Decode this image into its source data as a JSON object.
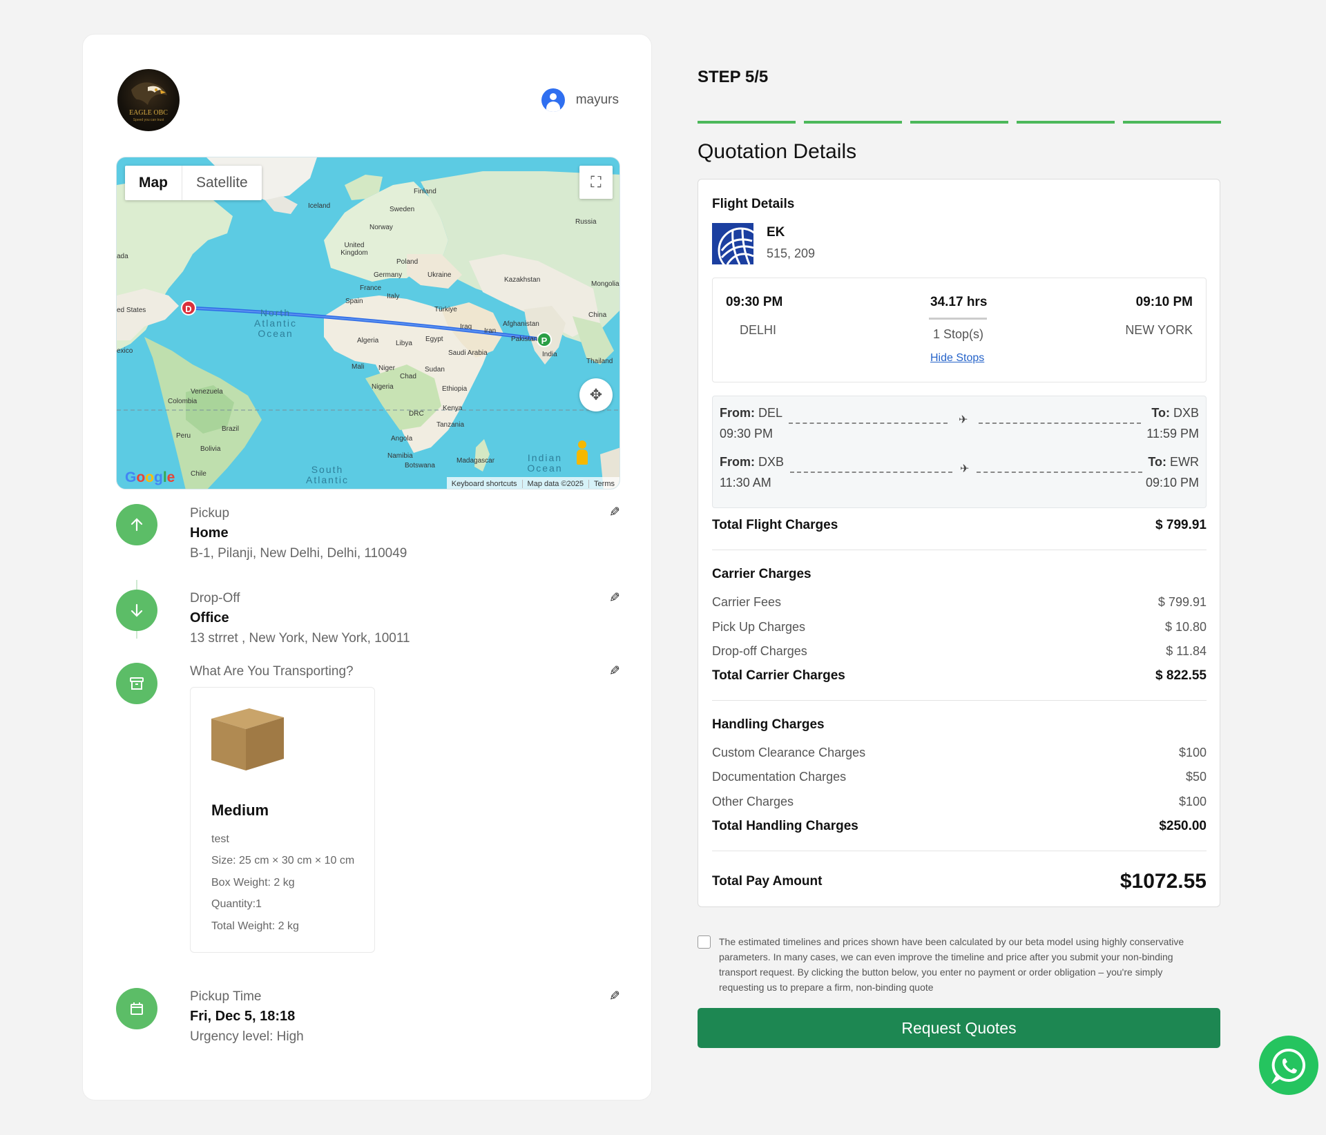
{
  "brand": {
    "logo_text": "EAGLE OBC",
    "logo_tagline": "Speed you can trust"
  },
  "user": {
    "name": "mayurs"
  },
  "map": {
    "toggle": [
      "Map",
      "Satellite"
    ],
    "labels": [
      "Iceland",
      "Finland",
      "Sweden",
      "Norway",
      "Russia",
      "United Kingdom",
      "Poland",
      "Germany",
      "Ukraine",
      "France",
      "Kazakhstan",
      "Mongolia",
      "Spain",
      "Italy",
      "Türkiye",
      "Afghanistan",
      "China",
      "Iraq",
      "Iran",
      "Algeria",
      "Libya",
      "Egypt",
      "Saudi Arabia",
      "Pakistan",
      "India",
      "Thailand",
      "Mali",
      "Niger",
      "Chad",
      "Sudan",
      "Nigeria",
      "Ethiopia",
      "Kenya",
      "DRC",
      "Tanzania",
      "Angola",
      "Namibia",
      "Botswana",
      "Madagascar",
      "Venezuela",
      "Colombia",
      "Peru",
      "Brazil",
      "Bolivia",
      "Chile",
      "ed States",
      "exico",
      "ada"
    ],
    "ocean_labels": [
      "North Atlantic Ocean",
      "South Atlantic",
      "Indian Ocean"
    ],
    "origin_pin": "D",
    "dest_pin": "P",
    "footer": [
      "Keyboard shortcuts",
      "Map data ©2025",
      "Terms"
    ],
    "google": "Google"
  },
  "pickup": {
    "label": "Pickup",
    "title": "Home",
    "address": "B-1, Pilanji, New Delhi, Delhi, 110049"
  },
  "dropoff": {
    "label": "Drop-Off",
    "title": "Office",
    "address": "13 strret , New York, New York, 10011"
  },
  "transport": {
    "label": "What Are You Transporting?",
    "package": {
      "name": "Medium",
      "desc": "test",
      "size": "Size: 25 cm × 30 cm × 10 cm",
      "weight": "Box Weight: 2 kg",
      "qty": "Quantity:1",
      "total": "Total Weight: 2 kg"
    }
  },
  "pickup_time": {
    "label": "Pickup Time",
    "value": "Fri, Dec 5, 18:18",
    "urgency": "Urgency level: High"
  },
  "step": "STEP 5/5",
  "progress_steps": 5,
  "quote_title": "Quotation Details",
  "flight": {
    "label": "Flight Details",
    "airline": "EK",
    "flight_numbers": "515, 209",
    "dep_time": "09:30 PM",
    "dep_city": "DELHI",
    "duration": "34.17 hrs",
    "stops": "1 Stop(s)",
    "hide_stops": "Hide Stops",
    "arr_time": "09:10 PM",
    "arr_city": "NEW YORK",
    "legs": [
      {
        "from_label": "From:",
        "from": "DEL",
        "dep": "09:30 PM",
        "to_label": "To:",
        "to": "DXB",
        "arr": "11:59 PM"
      },
      {
        "from_label": "From:",
        "from": "DXB",
        "dep": "11:30 AM",
        "to_label": "To:",
        "to": "EWR",
        "arr": "09:10 PM"
      }
    ],
    "total_label": "Total Flight Charges",
    "total": "$ 799.91"
  },
  "carrier": {
    "title": "Carrier Charges",
    "rows": [
      {
        "label": "Carrier Fees",
        "value": "$ 799.91"
      },
      {
        "label": "Pick Up Charges",
        "value": "$ 10.80"
      },
      {
        "label": "Drop-off Charges",
        "value": "$ 11.84"
      }
    ],
    "total_label": "Total Carrier Charges",
    "total": "$ 822.55"
  },
  "handling": {
    "title": "Handling Charges",
    "rows": [
      {
        "label": "Custom Clearance Charges",
        "value": "$100"
      },
      {
        "label": "Documentation Charges",
        "value": "$50"
      },
      {
        "label": "Other Charges",
        "value": "$100"
      }
    ],
    "total_label": "Total Handling Charges",
    "total": "$250.00"
  },
  "pay": {
    "label": "Total Pay Amount",
    "value": "$1072.55"
  },
  "disclaimer": "The estimated timelines and prices shown have been calculated by our beta model using highly conservative parameters. In many cases, we can even improve the timeline and price after you submit your non-binding transport request. By clicking the button below, you enter no payment or order obligation – you're simply requesting us to prepare a firm, non-binding quote",
  "request_button": "Request Quotes",
  "colors": {
    "accent_green": "#5cbd67",
    "button_green": "#1d8752",
    "progress": "#4cb85a",
    "link": "#2563c9"
  }
}
